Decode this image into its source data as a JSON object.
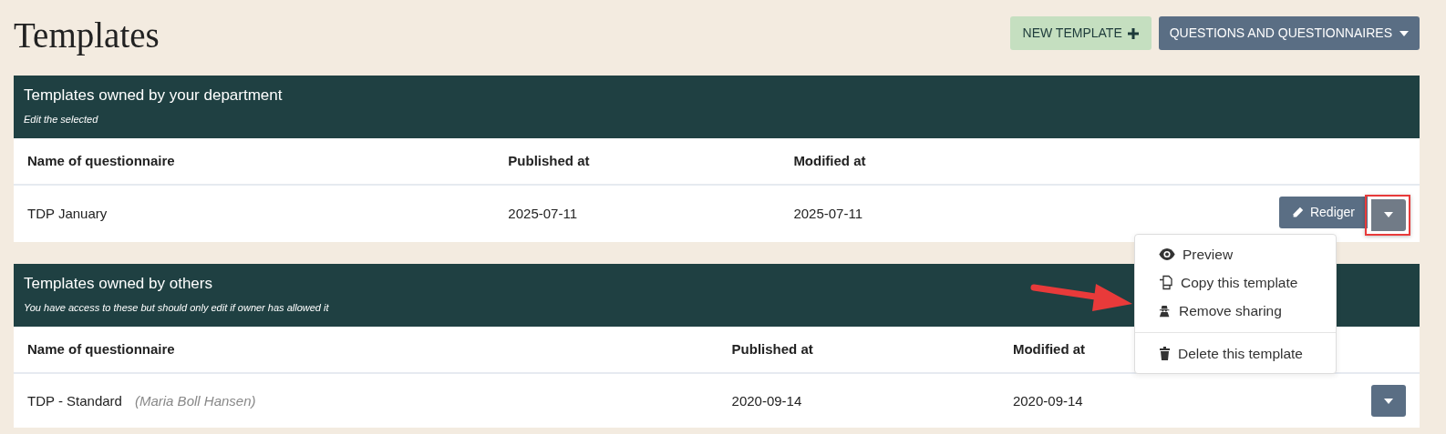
{
  "page": {
    "title": "Templates"
  },
  "toolbar": {
    "new_button": {
      "label": "NEW TEMPLATE"
    },
    "menu_button": {
      "label": "QUESTIONS AND QUESTIONNAIRES"
    }
  },
  "panels": [
    {
      "title": "Templates owned by your department",
      "subtitle": "Edit the selected",
      "columns": [
        "Name of questionnaire",
        "Published at",
        "Modified at"
      ],
      "rows": [
        {
          "name": "TDP January",
          "published": "2025-07-11",
          "modified": "2025-07-11",
          "edit_label": "Rediger",
          "toggle_highlighted": true,
          "menu_open": true
        }
      ]
    },
    {
      "title": "Templates owned by others",
      "subtitle": "You have access to these but should only edit if owner has allowed it",
      "columns": [
        "Name of questionnaire",
        "Published at",
        "Modified at"
      ],
      "rows": [
        {
          "name": "TDP - Standard",
          "owner": "(Maria Boll Hansen)",
          "published": "2020-09-14",
          "modified": "2020-09-14",
          "toggle_highlighted": false,
          "menu_open": false
        }
      ]
    }
  ],
  "row_menu": {
    "items": [
      {
        "kind": "preview",
        "label": "Preview",
        "divider_before": false
      },
      {
        "kind": "copy",
        "label": "Copy this template",
        "divider_before": false
      },
      {
        "kind": "unshare",
        "label": "Remove sharing",
        "divider_before": false
      },
      {
        "kind": "delete",
        "label": "Delete this template",
        "divider_before": true
      }
    ]
  }
}
